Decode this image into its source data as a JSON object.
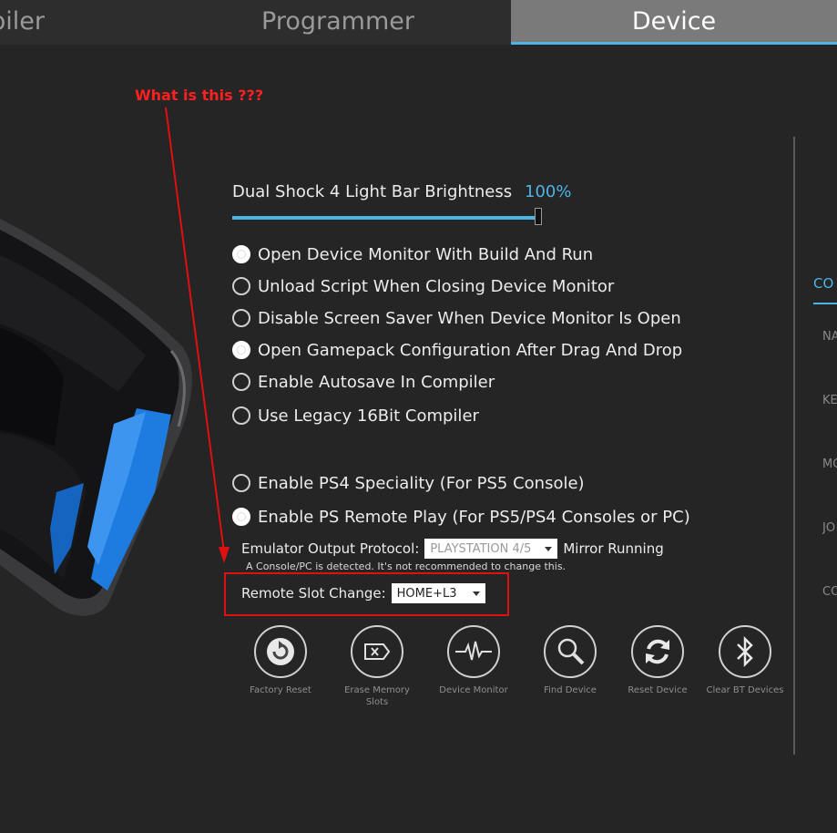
{
  "tabs": [
    {
      "label": "Compiler",
      "visible_text": "piler"
    },
    {
      "label": "Programmer"
    },
    {
      "label": "Device",
      "active": true
    }
  ],
  "annotation": {
    "text": "What is this ???",
    "color": "#ff2020"
  },
  "brightness": {
    "label": "Dual Shock 4 Light Bar Brightness",
    "value_text": "100%",
    "value": 100
  },
  "options": [
    {
      "label": "Open Device Monitor With Build And Run",
      "checked": true
    },
    {
      "label": "Unload Script When Closing Device Monitor",
      "checked": false
    },
    {
      "label": "Disable Screen Saver When Device Monitor Is Open",
      "checked": false
    },
    {
      "label": "Open Gamepack Configuration After Drag And Drop",
      "checked": true
    },
    {
      "label": "Enable Autosave In Compiler",
      "checked": false
    },
    {
      "label": "Use Legacy 16Bit Compiler",
      "checked": false
    },
    {
      "label": "Enable PS4 Speciality (For PS5 Console)",
      "checked": false
    },
    {
      "label": "Enable PS Remote Play (For PS5/PS4 Consoles or PC)",
      "checked": true
    }
  ],
  "emulator": {
    "label": "Emulator Output Protocol:",
    "selected": "PLAYSTATION 4/5",
    "status": "Mirror Running",
    "note": "A Console/PC is detected. It's not recommended to change this."
  },
  "remote_slot": {
    "label": "Remote Slot Change:",
    "selected": "HOME+L3"
  },
  "actions": [
    {
      "label": "Factory Reset",
      "icon": "factory-reset-icon"
    },
    {
      "label": "Erase Memory Slots",
      "icon": "erase-icon"
    },
    {
      "label": "Device Monitor",
      "icon": "pulse-icon"
    },
    {
      "label": "Find Device",
      "icon": "magnifier-icon"
    },
    {
      "label": "Reset Device",
      "icon": "refresh-icon"
    },
    {
      "label": "Clear BT Devices",
      "icon": "bluetooth-icon"
    }
  ],
  "right_panel": {
    "tab_fragment": "CO",
    "label_fragments": [
      "NA",
      "KE",
      "MO",
      "JO",
      "CO"
    ]
  },
  "colors": {
    "accent": "#4db4e6",
    "background": "#252526",
    "highlight": "#e01010",
    "controller_blue": "#1e7be0"
  }
}
